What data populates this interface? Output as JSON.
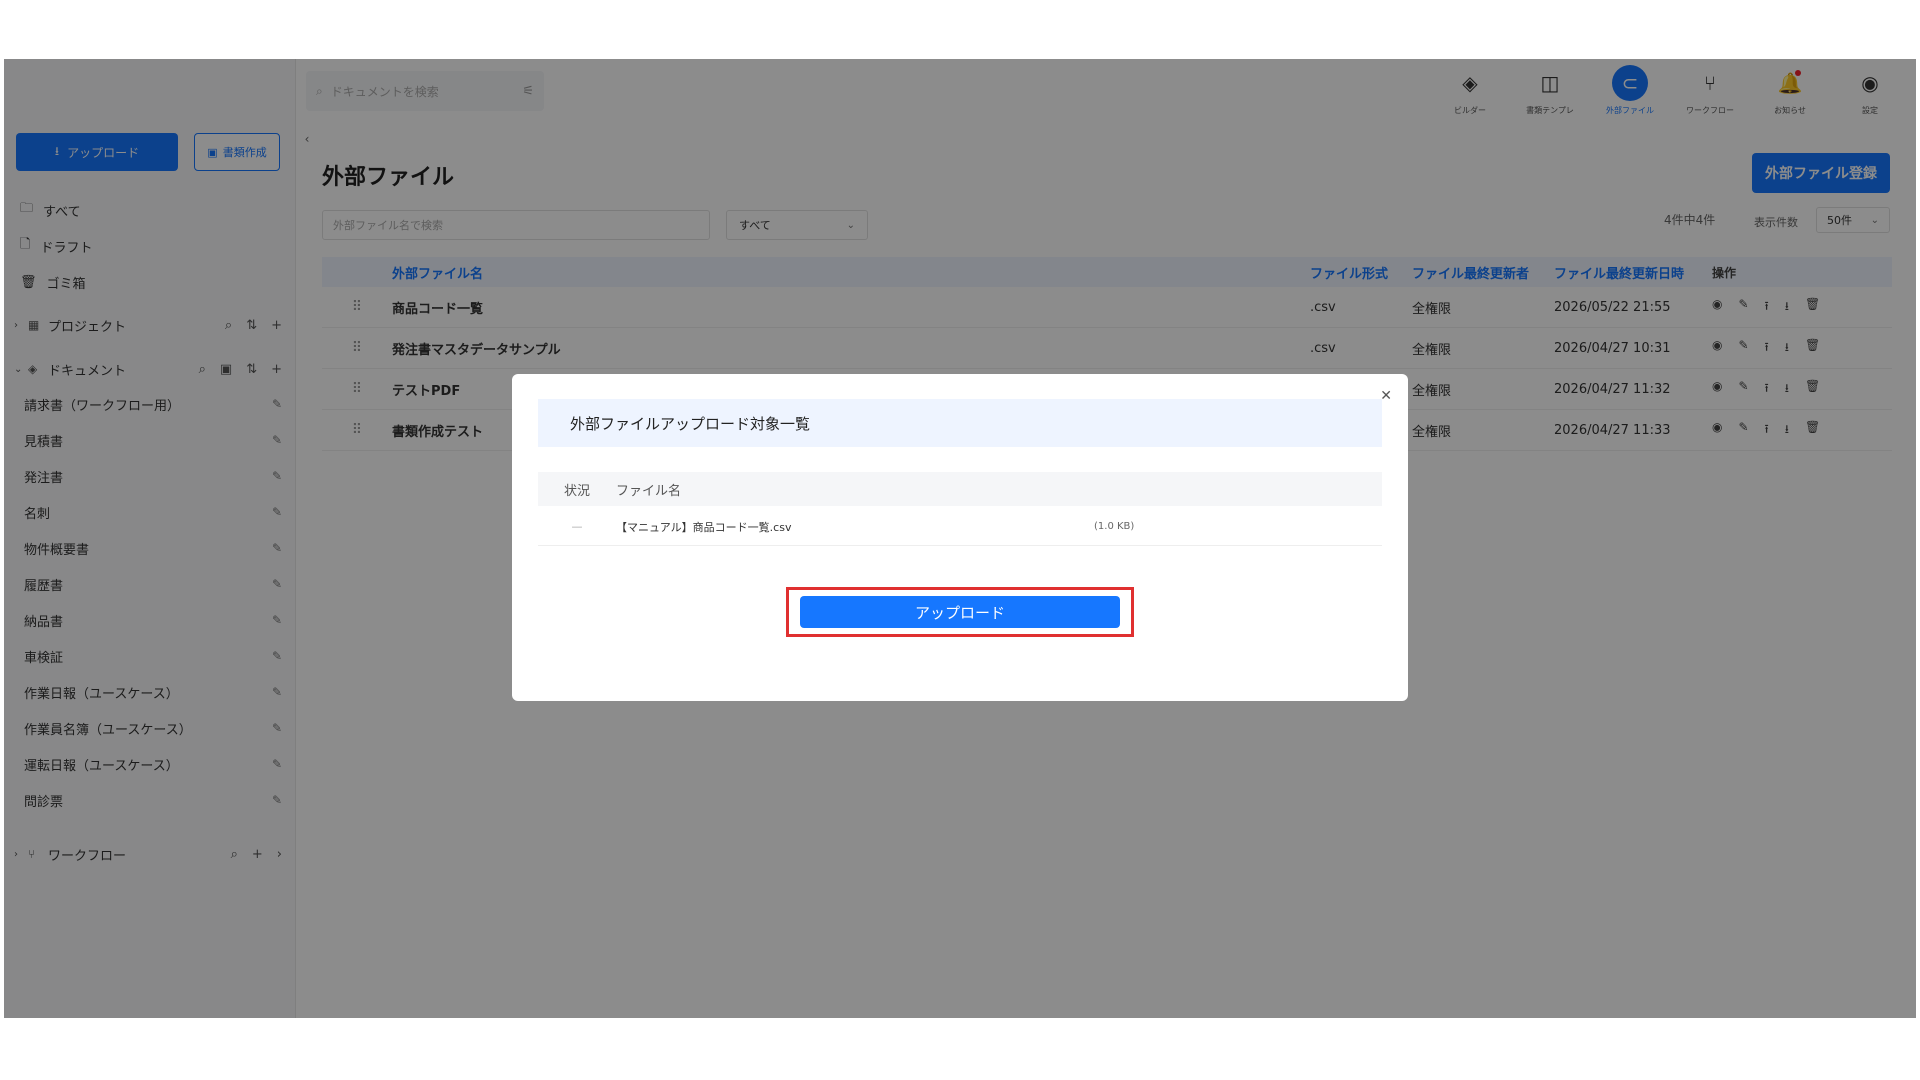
{
  "search": {
    "placeholder": "ドキュメントを検索"
  },
  "sidebar": {
    "upload_label": "アップロード",
    "create_label": "書類作成",
    "nav": [
      {
        "label": "すべて",
        "icon": "folder-icon"
      },
      {
        "label": "ドラフト",
        "icon": "file-icon"
      },
      {
        "label": "ゴミ箱",
        "icon": "trash-icon"
      }
    ],
    "projects_title": "プロジェクト",
    "documents_title": "ドキュメント",
    "documents": [
      "請求書（ワークフロー用）",
      "見積書",
      "発注書",
      "名刺",
      "物件概要書",
      "履歴書",
      "納品書",
      "車検証",
      "作業日報（ユースケース）",
      "作業員名簿（ユースケース）",
      "運転日報（ユースケース）",
      "問診票"
    ],
    "workflow_title": "ワークフロー"
  },
  "topnav": [
    {
      "label": "ビルダー",
      "icon": "layers-icon"
    },
    {
      "label": "書類テンプレ",
      "icon": "book-icon"
    },
    {
      "label": "外部ファイル",
      "icon": "link-icon",
      "active": true
    },
    {
      "label": "ワークフロー",
      "icon": "branch-icon"
    },
    {
      "label": "お知らせ",
      "icon": "bell-icon"
    },
    {
      "label": "設定",
      "icon": "user-icon"
    }
  ],
  "main": {
    "title": "外部ファイル",
    "register_label": "外部ファイル登録",
    "filter_placeholder": "外部ファイル名で検索",
    "filter_select": "すべて",
    "count": "4件中4件",
    "per_page_label": "表示件数",
    "per_page_value": "50件",
    "columns": [
      "外部ファイル名",
      "ファイル形式",
      "ファイル最終更新者",
      "ファイル最終更新日時",
      "操作"
    ],
    "rows": [
      {
        "name": "商品コード一覧",
        "type": ".csv",
        "user": "全権限",
        "date": "2026/05/22 21:55"
      },
      {
        "name": "発注書マスタデータサンプル",
        "type": ".csv",
        "user": "全権限",
        "date": "2026/04/27 10:31"
      },
      {
        "name": "テストPDF",
        "type": "",
        "user": "全権限",
        "date": "2026/04/27 11:32"
      },
      {
        "name": "書類作成テスト",
        "type": "",
        "user": "全権限",
        "date": "2026/04/27 11:33"
      }
    ]
  },
  "modal": {
    "title": "外部ファイルアップロード対象一覧",
    "col_status": "状況",
    "col_filename": "ファイル名",
    "file": {
      "status": "—",
      "name": "【マニュアル】商品コード一覧.csv",
      "size": "(1.0 KB)"
    },
    "upload_label": "アップロード"
  },
  "colors": {
    "accent": "#1677ff",
    "highlight": "#e03030"
  }
}
